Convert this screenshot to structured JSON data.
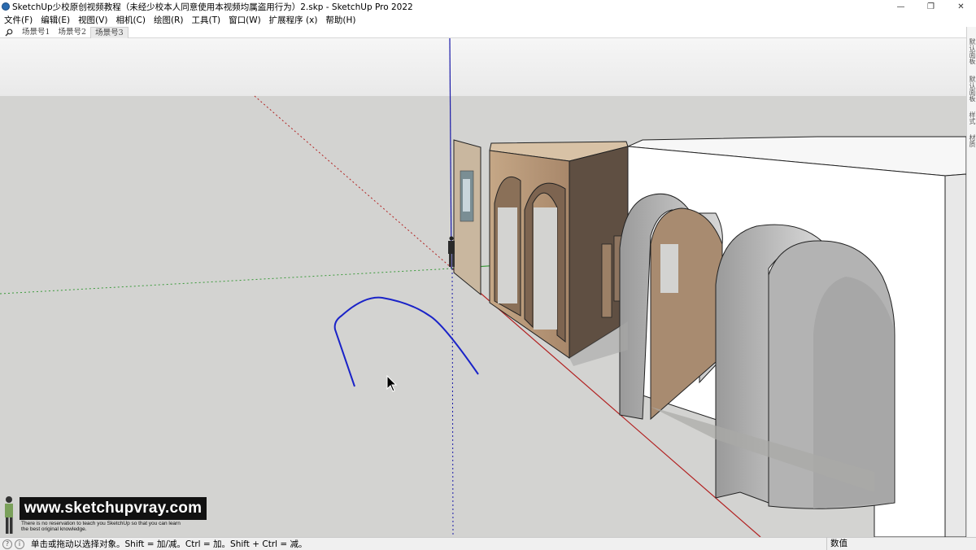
{
  "window": {
    "title": "SketchUp少校原创视频教程（未经少校本人同意使用本视频均属盗用行为）2.skp - SketchUp Pro 2022",
    "controls": {
      "minimize": "—",
      "restore": "❐",
      "close": "✕"
    }
  },
  "menu": {
    "items": [
      "文件(F)",
      "编辑(E)",
      "视图(V)",
      "相机(C)",
      "绘图(R)",
      "工具(T)",
      "窗口(W)",
      "扩展程序 (x)",
      "帮助(H)"
    ]
  },
  "scenes": {
    "search_icon": "magnifier-icon",
    "tabs": [
      "场景号1",
      "场景号2",
      "场景号3"
    ],
    "active_index": 2
  },
  "right_panel": {
    "tabs": [
      "默认面板",
      "默认面板",
      "样式",
      "材质"
    ]
  },
  "status": {
    "hint": "单击或拖动以选择对象。Shift = 加/减。Ctrl = 加。Shift + Ctrl = 减。",
    "vcb_label": "数值",
    "icons": [
      "geo-location-icon",
      "info-icon"
    ]
  },
  "watermark": {
    "site": "www.sketchupvray.com",
    "tagline_1": "There is no reservation to teach you SketchUp so that you can learn",
    "tagline_2": "the best original knowledge."
  },
  "colors": {
    "sky": "#f2f2f2",
    "ground": "#d3d3d1",
    "axis_red": "#b22222",
    "axis_green": "#3a9a3a",
    "axis_blue": "#1a1aa8",
    "curve": "#1a23c8",
    "wood": "#b39474"
  }
}
